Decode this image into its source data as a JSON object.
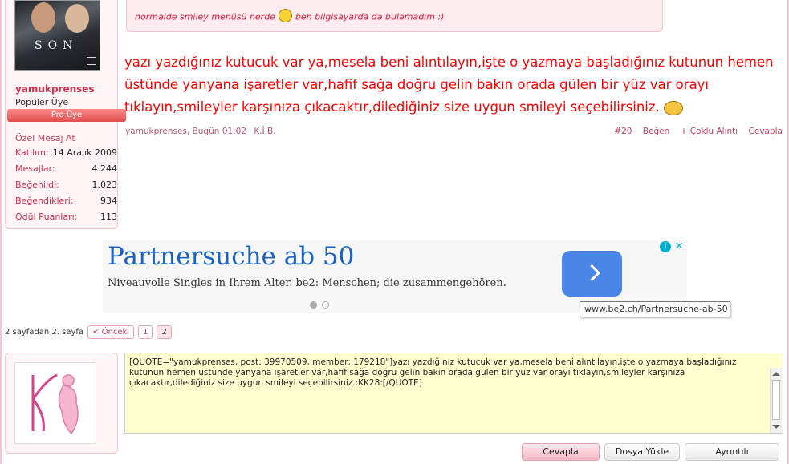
{
  "user": {
    "avatar_caption": "SON",
    "name": "yamukprenses",
    "title": "Popüler Üye",
    "badge": "Pro Üye",
    "pm_link": "Özel Mesaj At",
    "stats": [
      {
        "key": "Katılım:",
        "value": "14 Aralık 2009"
      },
      {
        "key": "Mesajlar:",
        "value": "4.244"
      },
      {
        "key": "Beğenildi:",
        "value": "1.023"
      },
      {
        "key": "Beğendikleri:",
        "value": "934"
      },
      {
        "key": "Ödül Puanları:",
        "value": "113"
      }
    ]
  },
  "quote": {
    "text_before": "normalde smiley menüsü nerde",
    "text_after": "ben bilgisayarda da bulamadım :)",
    "smiley_icon": "confused-smiley-icon"
  },
  "message": {
    "text": "yazı yazdığınız kutucuk var ya,mesela beni alıntılayın,işte o yazmaya başladığınız kutunun hemen üstünde yanyana işaretler var,hafif sağa doğru gelin bakın orada gülen bir yüz var orayı tıklayın,smileyler karşınıza çıkacaktır,dilediğiniz size uygun smileyi seçebilirsiniz.",
    "smiley_icon": "blushing-smiley-icon"
  },
  "post": {
    "author_date": "yamukprenses, Bugün 01:02",
    "kib": "K.İ.B.",
    "number": "#20",
    "like": "Beğen",
    "multi_quote": "+ Çoklu Alıntı",
    "reply": "Cevapla"
  },
  "ad": {
    "title": "Partnersuche ab 50",
    "subtitle": "Niveauvolle Singles in Ihrem Alter. be2: Menschen; die zusammengehören.",
    "tooltip": "www.be2.ch/Partnersuche-ab-50"
  },
  "pager": {
    "label": "2 sayfadan 2. sayfa",
    "prev": "< Önceki",
    "pages": [
      "1",
      "2"
    ]
  },
  "reply_box": {
    "value": "[QUOTE=\"yamukprenses, post: 39970509, member: 179218\"]yazı yazdığınız kutucuk var ya,mesela beni alıntılayın,işte o yazmaya başladığınız kutunun hemen üstünde yanyana işaretler var,hafif sağa doğru gelin bakın orada gülen bir yüz var orayı tıklayın,smileyler karşınıza çıkacaktır,dilediğiniz size uygun smileyi seçebilirsiniz.:KK28:[/QUOTE]"
  },
  "buttons": {
    "reply": "Cevapla",
    "upload": "Dosya Yükle",
    "advanced": "Ayrıntılı Düzenleme..."
  },
  "colors": {
    "accent": "#d0304e",
    "message_red": "#ff0000",
    "ad_blue": "#1a63c4"
  }
}
